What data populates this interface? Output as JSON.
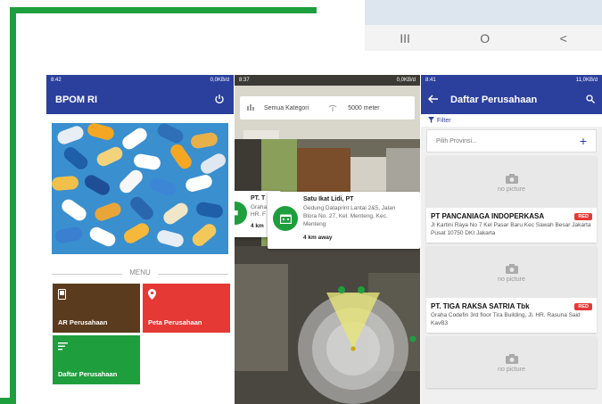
{
  "colors": {
    "frame_green": "#1f9e3e",
    "appbar_blue": "#2b3f9c",
    "badge_red": "#e53935"
  },
  "frag_nav": {
    "recent": "III",
    "home": "O",
    "back": "<"
  },
  "phone1": {
    "status_time": "8:42",
    "status_right": "0,0KB/d",
    "title": "BPOM RI",
    "power_icon": "power-icon",
    "menu_label": "MENU",
    "tiles": [
      {
        "label": "AR Perusahaan",
        "color": "#5b3b1d",
        "icon": "phone-icon"
      },
      {
        "label": "Peta Perusahaan",
        "color": "#e53935",
        "icon": "map-pin-icon"
      },
      {
        "label": "Daftar Perusahaan",
        "color": "#1f9e3e",
        "icon": "list-icon"
      }
    ]
  },
  "phone2": {
    "status_time": "8:37",
    "status_right": "0,0KB/d",
    "category": "Semua Kategori",
    "distance": "5000 meter",
    "poi_back": {
      "title": "PT. T",
      "addr1": "Graha",
      "addr2": "HR. F",
      "dist": "4 km"
    },
    "poi_front": {
      "title": "Satu Ikat Lidi, PT",
      "addr1": "Gedung Dataprint Lantai 2&5, Jalan",
      "addr2": "Blora No. 27, Kel. Menteng, Kec.",
      "addr3": "Menteng",
      "dist": "4 km away"
    }
  },
  "phone3": {
    "status_time": "8:41",
    "status_right": "11,0KB/d",
    "title": "Daftar Perusahaan",
    "filter_label": "Filter",
    "province_placeholder": "Pilih Provinsi...",
    "no_picture": "no picture",
    "companies": [
      {
        "name": "PT PANCANIAGA INDOPERKASA",
        "badge": "RED",
        "address": "Jl Kartini Raya No 7 Kel Pasar Baru Kec Sawah Besar Jakarta Pusat 10750 DKI Jakarta"
      },
      {
        "name": "PT. TIGA RAKSA SATRIA Tbk",
        "badge": "RED",
        "address": "Graha Codefin 3rd floor Tira Building, Jl. HR. Rasuna Said KavB3"
      }
    ]
  }
}
